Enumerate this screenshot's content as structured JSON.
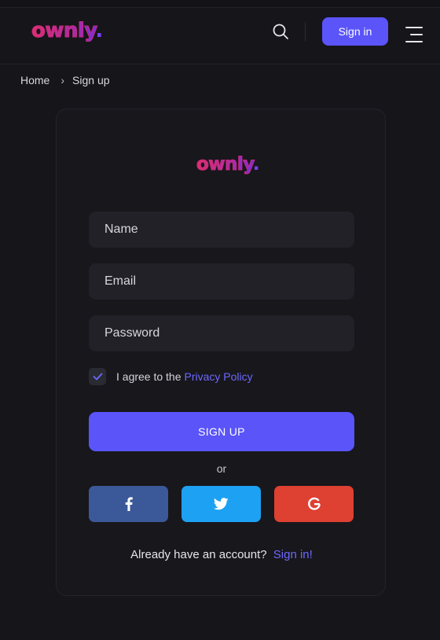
{
  "brand": {
    "logo_text": "ownly",
    "logo_dot": "."
  },
  "header": {
    "signin_label": "Sign in",
    "search_icon": "search-icon",
    "menu_icon": "hamburger-menu-icon"
  },
  "breadcrumb": {
    "home": "Home",
    "separator": "›",
    "current": "Sign up"
  },
  "form": {
    "name_placeholder": "Name",
    "email_placeholder": "Email",
    "password_placeholder": "Password",
    "agree_text": "I agree to the",
    "privacy_link": "Privacy Policy",
    "agree_checked": true,
    "submit_label": "SIGN UP",
    "or_text": "or"
  },
  "social": {
    "facebook_icon": "facebook-icon",
    "facebook_color": "#3b5998",
    "twitter_icon": "twitter-icon",
    "twitter_color": "#1da1f2",
    "google_icon": "google-icon",
    "google_color": "#de4032"
  },
  "footer": {
    "already_text": "Already have an account?",
    "signin_link": "Sign in!"
  },
  "colors": {
    "accent": "#5a54f9",
    "link": "#6d68ff",
    "background": "#16151a"
  }
}
